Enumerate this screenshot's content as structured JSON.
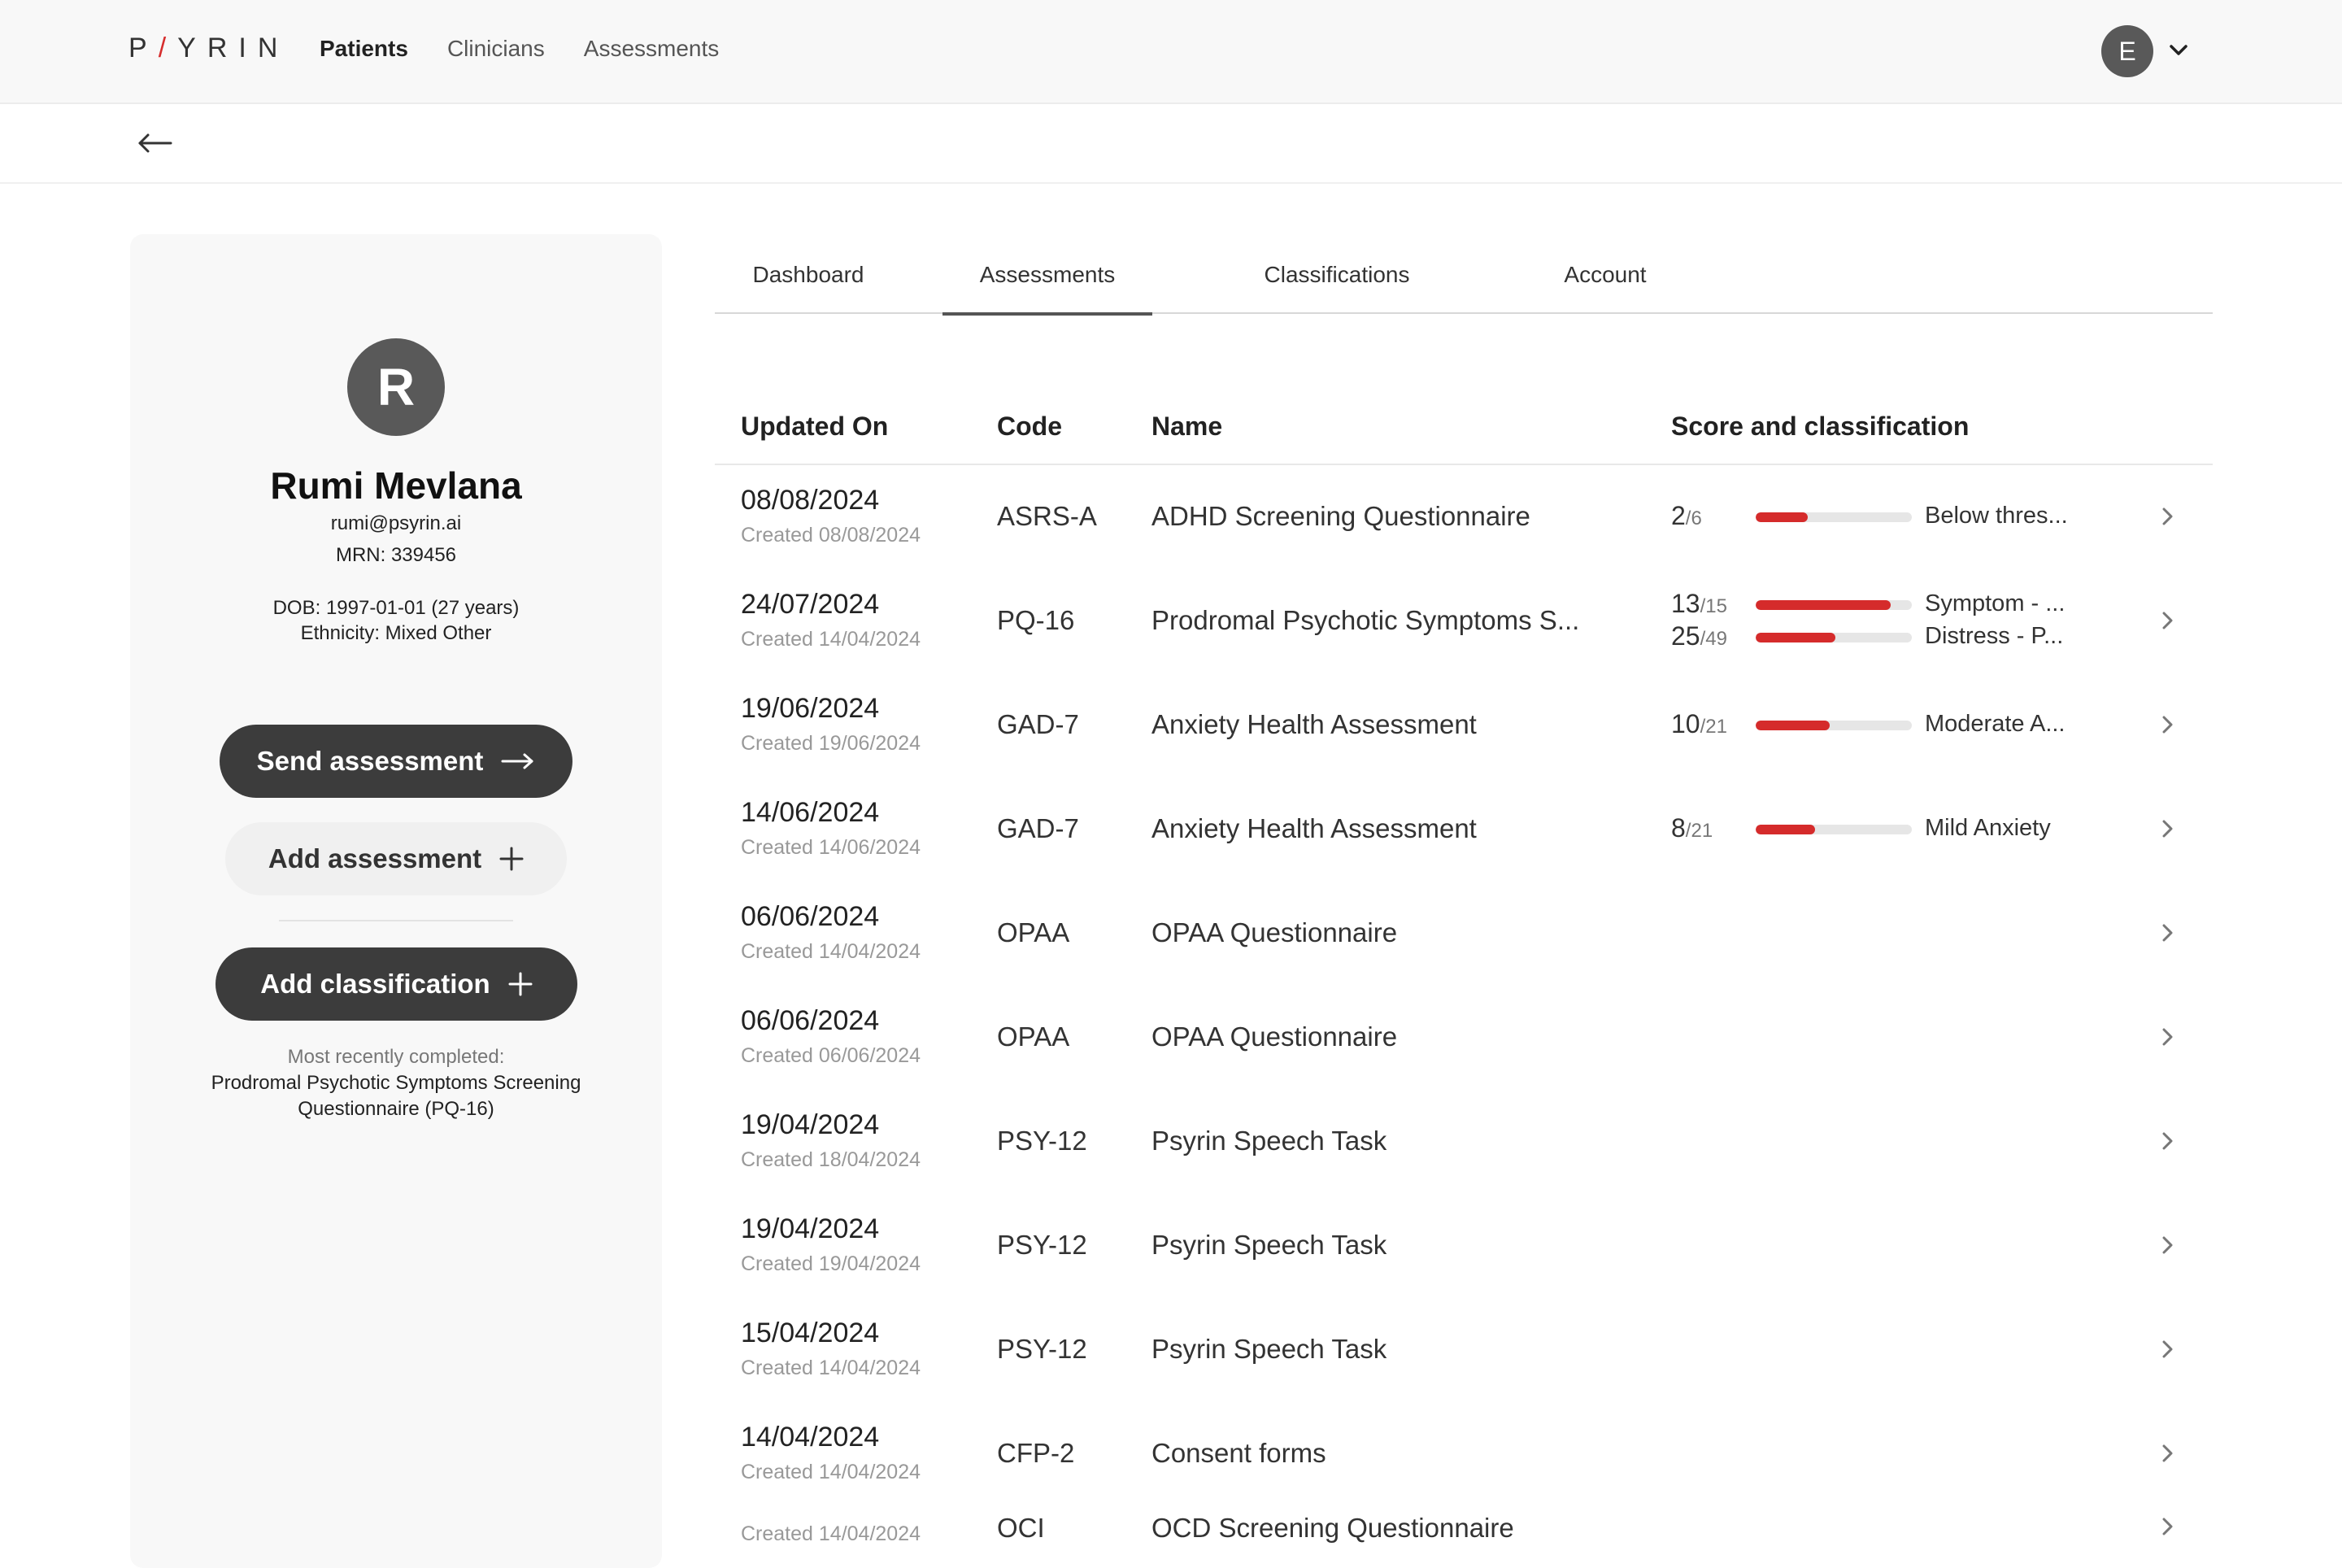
{
  "brand": {
    "logo": "P/YRIN",
    "accent": "#d62d2d"
  },
  "nav": {
    "items": [
      {
        "label": "Patients",
        "active": true
      },
      {
        "label": "Clinicians",
        "active": false
      },
      {
        "label": "Assessments",
        "active": false
      }
    ],
    "user_initial": "E"
  },
  "patient": {
    "initial": "R",
    "name": "Rumi Mevlana",
    "email": "rumi@psyrin.ai",
    "mrn": "MRN: 339456",
    "dob": "DOB: 1997-01-01 (27 years)",
    "ethnicity": "Ethnicity: Mixed Other",
    "send_assessment": "Send assessment",
    "add_assessment": "Add assessment",
    "add_classification": "Add classification",
    "recent_label": "Most recently completed:",
    "recent_line1": "Prodromal Psychotic Symptoms Screening",
    "recent_line2": "Questionnaire (PQ-16)"
  },
  "tabs": [
    {
      "label": "Dashboard",
      "active": false
    },
    {
      "label": "Assessments",
      "active": true
    },
    {
      "label": "Classifications",
      "active": false
    },
    {
      "label": "Account",
      "active": false
    }
  ],
  "table": {
    "headers": {
      "updated": "Updated On",
      "code": "Code",
      "name": "Name",
      "score": "Score and classification"
    },
    "rows": [
      {
        "updated": "08/08/2024",
        "created": "Created 08/08/2024",
        "code": "ASRS-A",
        "name": "ADHD Screening Questionnaire",
        "scores": [
          {
            "score": "2",
            "max": "/6",
            "fraction": 0.333,
            "label": "Below thres..."
          }
        ]
      },
      {
        "updated": "24/07/2024",
        "created": "Created 14/04/2024",
        "code": "PQ-16",
        "name": "Prodromal Psychotic Symptoms S...",
        "scores": [
          {
            "score": "13",
            "max": "/15",
            "fraction": 0.867,
            "label": "Symptom - ..."
          },
          {
            "score": "25",
            "max": "/49",
            "fraction": 0.51,
            "label": "Distress - P..."
          }
        ]
      },
      {
        "updated": "19/06/2024",
        "created": "Created 19/06/2024",
        "code": "GAD-7",
        "name": "Anxiety Health Assessment",
        "scores": [
          {
            "score": "10",
            "max": "/21",
            "fraction": 0.476,
            "label": "Moderate A..."
          }
        ]
      },
      {
        "updated": "14/06/2024",
        "created": "Created 14/06/2024",
        "code": "GAD-7",
        "name": "Anxiety Health Assessment",
        "scores": [
          {
            "score": "8",
            "max": "/21",
            "fraction": 0.381,
            "label": "Mild Anxiety"
          }
        ]
      },
      {
        "updated": "06/06/2024",
        "created": "Created 14/04/2024",
        "code": "OPAA",
        "name": "OPAA Questionnaire",
        "scores": []
      },
      {
        "updated": "06/06/2024",
        "created": "Created 06/06/2024",
        "code": "OPAA",
        "name": "OPAA Questionnaire",
        "scores": []
      },
      {
        "updated": "19/04/2024",
        "created": "Created 18/04/2024",
        "code": "PSY-12",
        "name": "Psyrin Speech Task",
        "scores": []
      },
      {
        "updated": "19/04/2024",
        "created": "Created 19/04/2024",
        "code": "PSY-12",
        "name": "Psyrin Speech Task",
        "scores": []
      },
      {
        "updated": "15/04/2024",
        "created": "Created 14/04/2024",
        "code": "PSY-12",
        "name": "Psyrin Speech Task",
        "scores": []
      },
      {
        "updated": "14/04/2024",
        "created": "Created 14/04/2024",
        "code": "CFP-2",
        "name": "Consent forms",
        "scores": []
      },
      {
        "updated": "",
        "created": "Created 14/04/2024",
        "code": "OCI",
        "name": "OCD Screening Questionnaire",
        "scores": []
      }
    ]
  }
}
